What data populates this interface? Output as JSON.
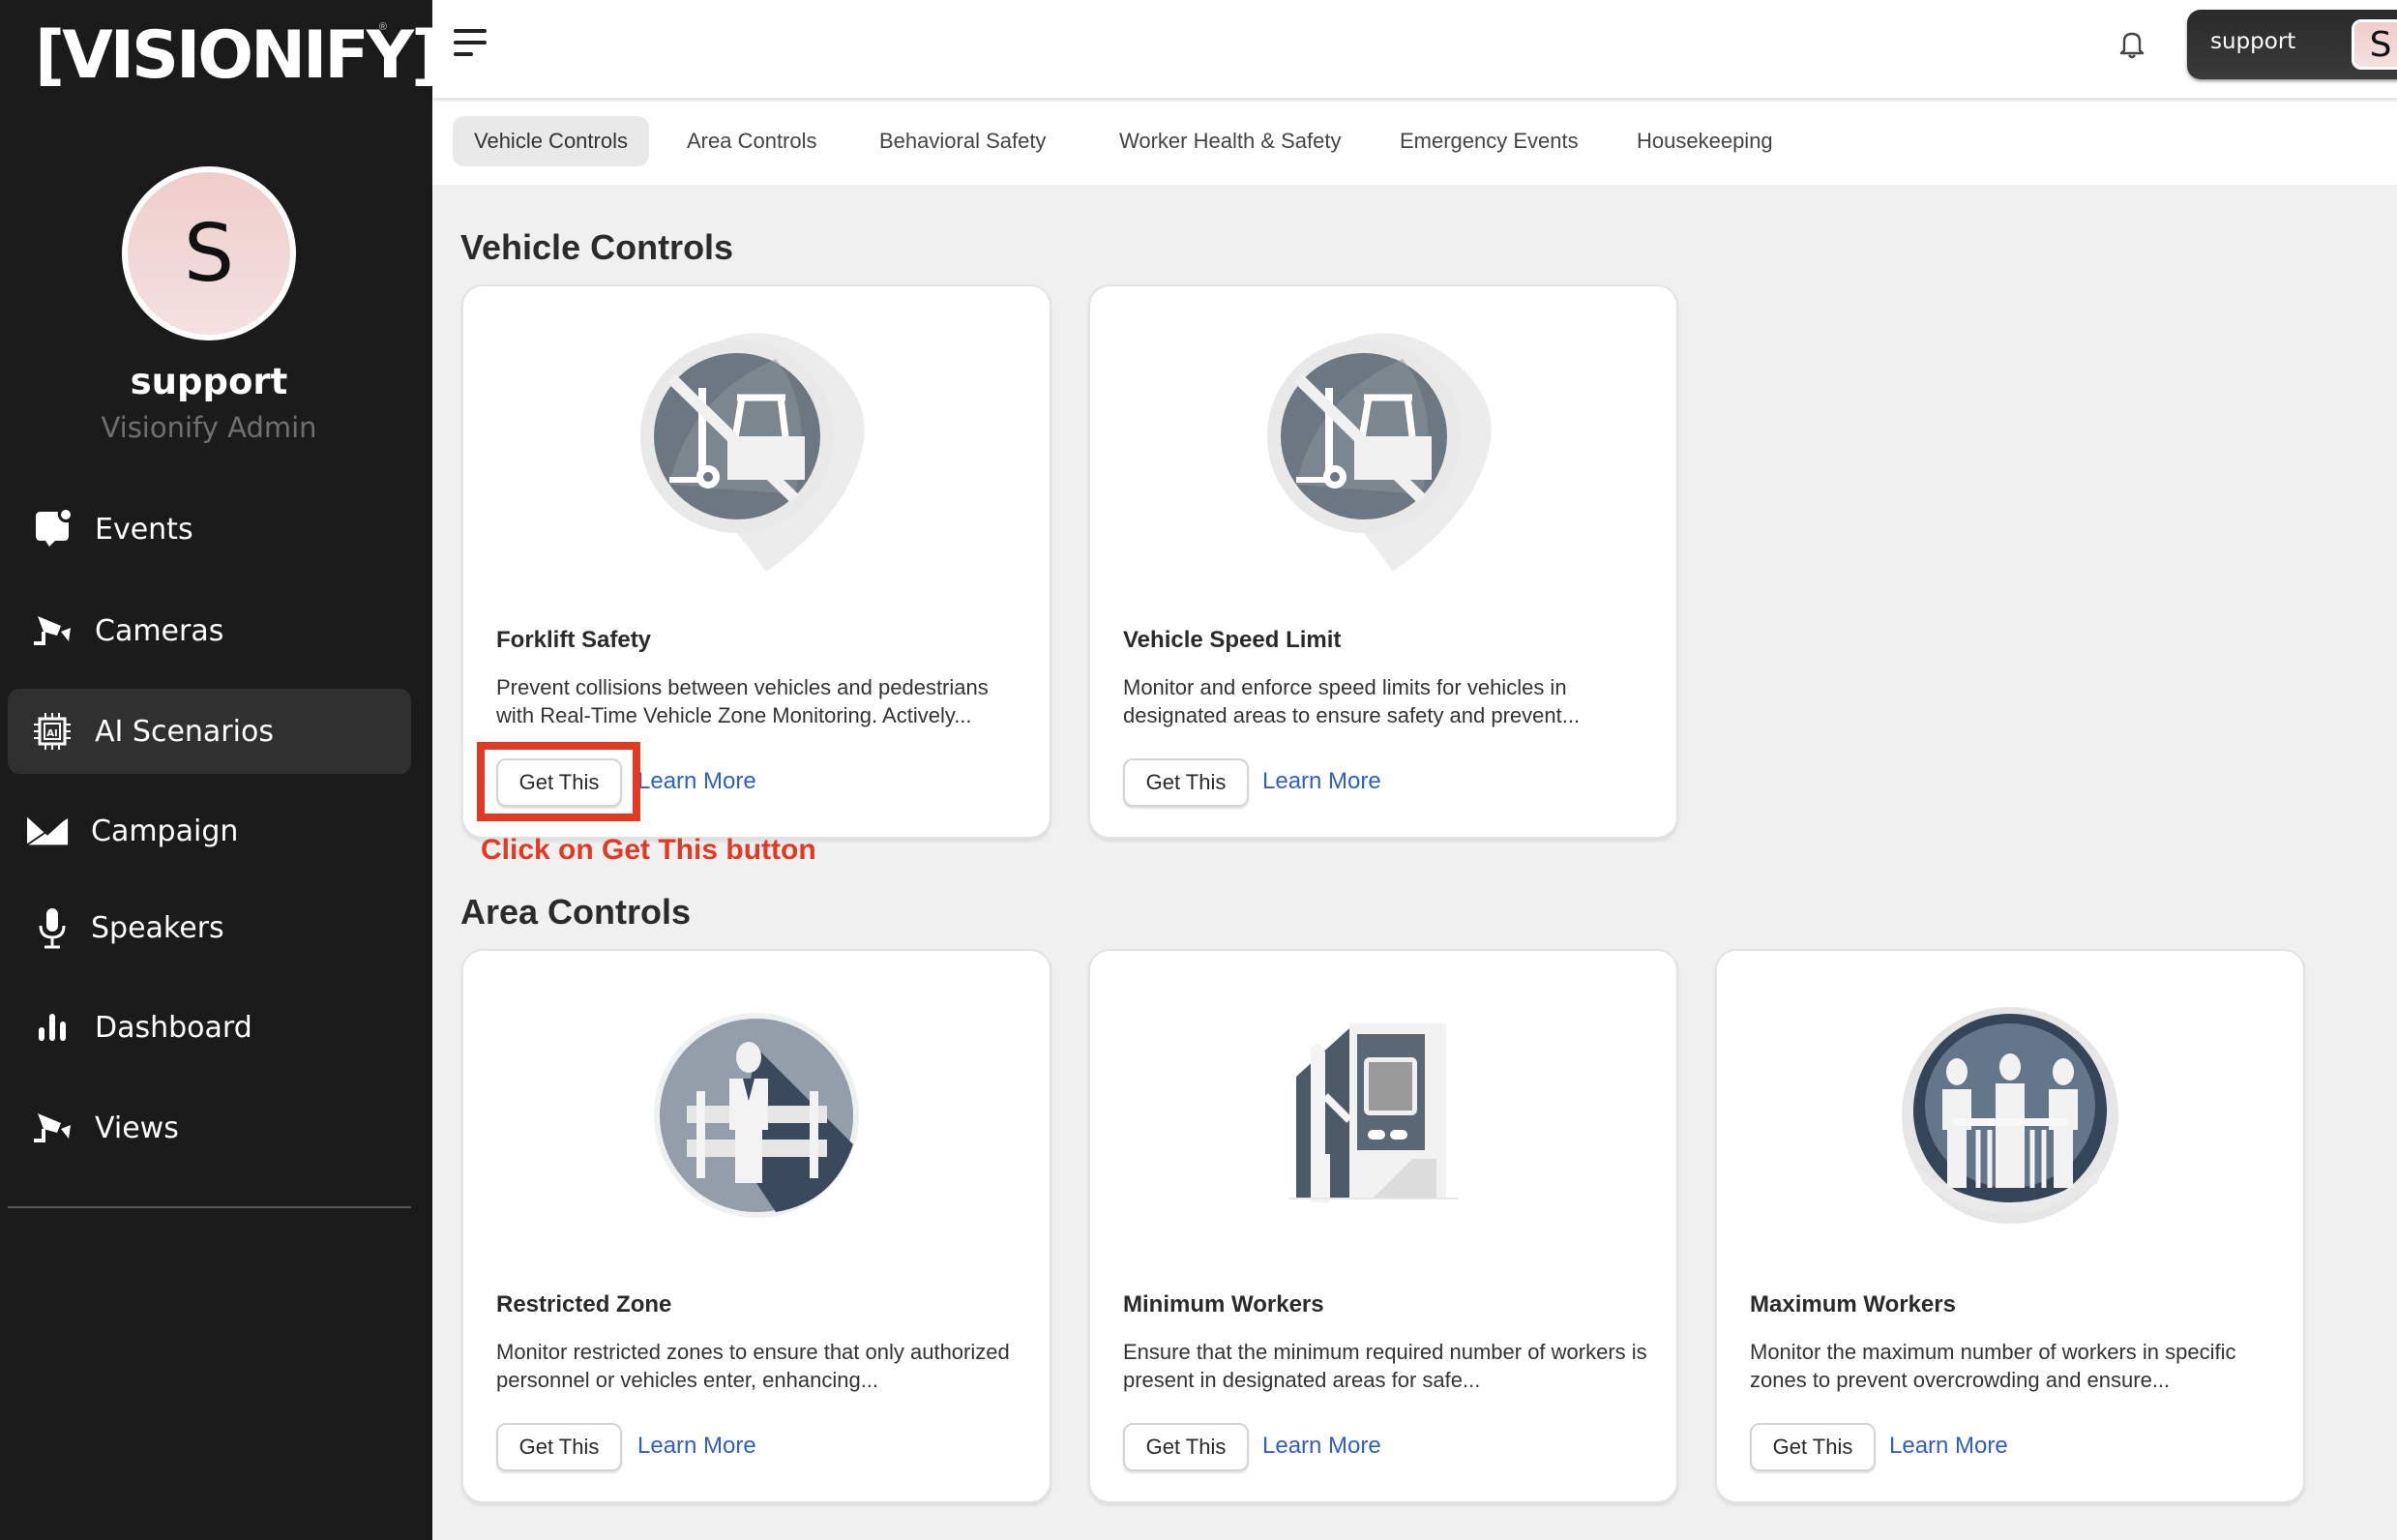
{
  "brand": {
    "logo_text": "[VISIONIFY]",
    "registered": "®"
  },
  "user": {
    "initial": "S",
    "name": "support",
    "role": "Visionify Admin"
  },
  "sidebar": {
    "items": [
      {
        "label": "Events",
        "icon": "chat-bubble-notification-icon",
        "active": false
      },
      {
        "label": "Cameras",
        "icon": "cctv-camera-icon",
        "active": false
      },
      {
        "label": "AI Scenarios",
        "icon": "ai-chip-icon",
        "active": true
      },
      {
        "label": "Campaign",
        "icon": "envelope-icon",
        "active": false
      },
      {
        "label": "Speakers",
        "icon": "microphone-icon",
        "active": false
      },
      {
        "label": "Dashboard",
        "icon": "bar-chart-icon",
        "active": false
      },
      {
        "label": "Views",
        "icon": "cctv-camera-icon",
        "active": false
      }
    ]
  },
  "header": {
    "menu_icon": "hamburger-menu-icon",
    "bell_icon": "bell-icon",
    "profile": {
      "name": "support",
      "initial": "S"
    }
  },
  "tabs": [
    {
      "label": "Vehicle Controls",
      "active": true
    },
    {
      "label": "Area Controls",
      "active": false
    },
    {
      "label": "Behavioral Safety",
      "active": false
    },
    {
      "label": "Worker Health & Safety",
      "active": false
    },
    {
      "label": "Emergency Events",
      "active": false
    },
    {
      "label": "Housekeeping",
      "active": false
    }
  ],
  "sections": [
    {
      "title": "Vehicle Controls",
      "cards": [
        {
          "title": "Forklift Safety",
          "description": "Prevent collisions between vehicles and pedestrians with Real-Time Vehicle Zone Monitoring. Actively...",
          "image": "no-forklift-sign-illustration",
          "get_label": "Get This",
          "learn_label": "Learn More"
        },
        {
          "title": "Vehicle Speed Limit",
          "description": "Monitor and enforce speed limits for vehicles in designated areas to ensure safety and prevent...",
          "image": "no-forklift-sign-illustration",
          "get_label": "Get This",
          "learn_label": "Learn More"
        }
      ]
    },
    {
      "title": "Area Controls",
      "cards": [
        {
          "title": "Restricted Zone",
          "description": "Monitor restricted zones to ensure that only authorized personnel or vehicles enter, enhancing...",
          "image": "person-behind-fence-illustration",
          "get_label": "Get This",
          "learn_label": "Learn More"
        },
        {
          "title": "Minimum Workers",
          "description": "Ensure that the minimum required number of workers is present in designated areas for safe...",
          "image": "worker-at-kiosk-illustration",
          "get_label": "Get This",
          "learn_label": "Learn More"
        },
        {
          "title": "Maximum Workers",
          "description": "Monitor the maximum number of workers in specific zones to prevent overcrowding and ensure...",
          "image": "three-workers-at-table-illustration",
          "get_label": "Get This",
          "learn_label": "Learn More"
        }
      ]
    }
  ],
  "annotation": {
    "text": "Click on Get This button",
    "color": "#e23a22"
  },
  "colors": {
    "sidebar_bg": "#1b1b1b",
    "active_nav_bg": "#303030",
    "link": "#2f5fbf",
    "page_bg": "#f0f0f0"
  }
}
